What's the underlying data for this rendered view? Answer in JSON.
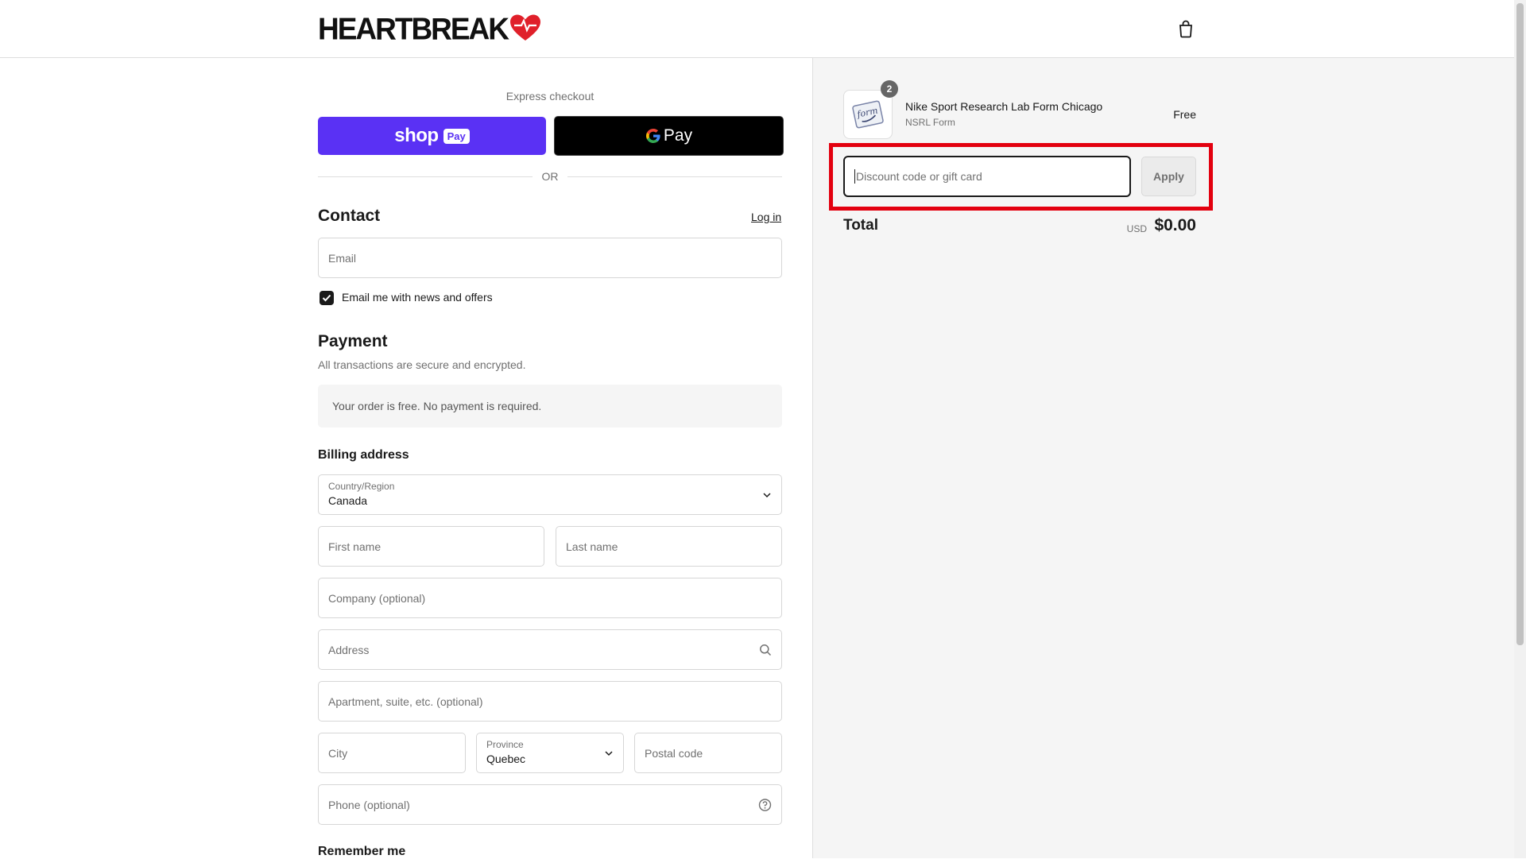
{
  "brand": {
    "logo_text": "HEARTBREAK",
    "logo_color": "#111111",
    "heart_color": "#e0202a"
  },
  "header": {
    "cart_icon": "shopping-bag-icon"
  },
  "express": {
    "label": "Express checkout",
    "shop_pay": {
      "shop": "shop",
      "pay": "Pay",
      "color": "#5a31f4"
    },
    "google_pay": {
      "g": "G",
      "pay": "Pay"
    },
    "or_text": "OR"
  },
  "contact": {
    "title": "Contact",
    "login_label": "Log in",
    "email_placeholder": "Email",
    "newsletter_label": "Email me with news and offers",
    "newsletter_checked": true
  },
  "payment": {
    "title": "Payment",
    "subtitle": "All transactions are secure and encrypted.",
    "free_notice": "Your order is free. No payment is required."
  },
  "billing": {
    "title": "Billing address",
    "country_label": "Country/Region",
    "country_value": "Canada",
    "first_name": "First name",
    "last_name": "Last name",
    "company": "Company (optional)",
    "address": "Address",
    "apartment": "Apartment, suite, etc. (optional)",
    "city": "City",
    "province_label": "Province",
    "province_value": "Quebec",
    "postal": "Postal code",
    "phone": "Phone (optional)"
  },
  "remember": {
    "title": "Remember me"
  },
  "summary": {
    "item": {
      "name": "Nike Sport Research Lab Form Chicago",
      "variant": "NSRL Form",
      "price": "Free",
      "quantity": "2",
      "thumb_text": "form"
    },
    "discount_placeholder": "Discount code or gift card",
    "apply_label": "Apply",
    "total_label": "Total",
    "currency": "USD",
    "total_value": "$0.00"
  },
  "highlight_color": "#e3000f"
}
